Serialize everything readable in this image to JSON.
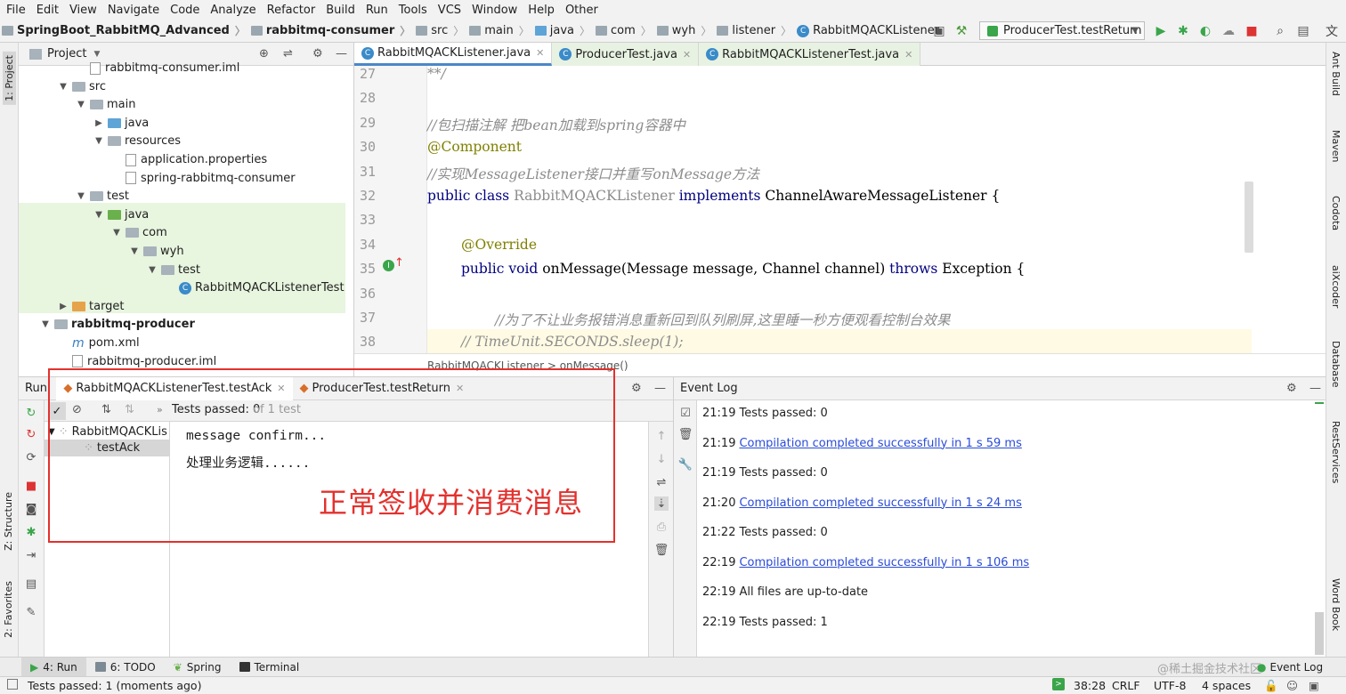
{
  "menu": [
    "File",
    "Edit",
    "View",
    "Navigate",
    "Code",
    "Analyze",
    "Refactor",
    "Build",
    "Run",
    "Tools",
    "VCS",
    "Window",
    "Help",
    "Other"
  ],
  "nav": {
    "crumbs": [
      "SpringBoot_RabbitMQ_Advanced",
      "rabbitmq-consumer",
      "src",
      "main",
      "java",
      "com",
      "wyh",
      "listener",
      "RabbitMQACKListener"
    ],
    "run_config": "ProducerTest.testReturn"
  },
  "left_stripe": {
    "project": "1: Project",
    "structure": "Z: Structure",
    "favorites": "2: Favorites"
  },
  "right_stripe": [
    "Ant Build",
    "Maven",
    "Codota",
    "aiXcoder",
    "Database",
    "RestServices",
    "Word Book"
  ],
  "project": {
    "title": "Project",
    "tree": [
      {
        "label": "rabbitmq-consumer.iml",
        "depth": 3,
        "icon": "file"
      },
      {
        "label": "src",
        "depth": 2,
        "icon": "grey",
        "arrow": "v"
      },
      {
        "label": "main",
        "depth": 3,
        "icon": "grey",
        "arrow": "v"
      },
      {
        "label": "java",
        "depth": 4,
        "icon": "blue",
        "arrow": ">"
      },
      {
        "label": "resources",
        "depth": 4,
        "icon": "grey",
        "arrow": "v"
      },
      {
        "label": "application.properties",
        "depth": 5,
        "icon": "file"
      },
      {
        "label": "spring-rabbitmq-consumer",
        "depth": 5,
        "icon": "file"
      },
      {
        "label": "test",
        "depth": 3,
        "icon": "grey",
        "arrow": "v"
      },
      {
        "label": "java",
        "depth": 4,
        "icon": "green",
        "arrow": "v"
      },
      {
        "label": "com",
        "depth": 5,
        "icon": "grey",
        "arrow": "v"
      },
      {
        "label": "wyh",
        "depth": 6,
        "icon": "grey",
        "arrow": "v"
      },
      {
        "label": "test",
        "depth": 7,
        "icon": "grey",
        "arrow": "v"
      },
      {
        "label": "RabbitMQACKListenerTest",
        "depth": 8,
        "icon": "class"
      },
      {
        "label": "target",
        "depth": 2,
        "icon": "orange",
        "arrow": ">"
      },
      {
        "label": "rabbitmq-producer",
        "depth": 1,
        "icon": "grey",
        "arrow": "v",
        "bold": true
      },
      {
        "label": "pom.xml",
        "depth": 2,
        "icon": "maven"
      },
      {
        "label": "rabbitmq-producer.iml",
        "depth": 2,
        "icon": "file"
      }
    ]
  },
  "editor": {
    "tabs": [
      "RabbitMQACKListener.java",
      "ProducerTest.java",
      "RabbitMQACKListenerTest.java"
    ],
    "lines": [
      {
        "n": "27",
        "text": "**/",
        "kind": "cmt",
        "indent": 0
      },
      {
        "n": "28",
        "text": "",
        "kind": "plain",
        "indent": 0
      },
      {
        "n": "29",
        "text": "//包扫描注解 把bean加载到spring容器中",
        "kind": "cmt",
        "indent": 0
      },
      {
        "n": "30",
        "text": "@Component",
        "kind": "ann",
        "indent": 0
      },
      {
        "n": "31",
        "text": "//实现MessageListener接口并重写onMessage方法",
        "kind": "cmt",
        "indent": 0
      },
      {
        "n": "32",
        "text": "",
        "kind": "classdecl",
        "indent": 0
      },
      {
        "n": "33",
        "text": "",
        "kind": "plain",
        "indent": 0
      },
      {
        "n": "34",
        "text": "@Override",
        "kind": "ann",
        "indent": 1
      },
      {
        "n": "35",
        "text": "",
        "kind": "methoddecl",
        "indent": 1
      },
      {
        "n": "36",
        "text": "",
        "kind": "plain",
        "indent": 0
      },
      {
        "n": "37",
        "text": "//为了不让业务报错消息重新回到队列刷屏,这里睡一秒方便观看控制台效果",
        "kind": "cmt",
        "indent": 2
      },
      {
        "n": "38",
        "text": "// TimeUnit.SECONDS.sleep(1);",
        "kind": "cmt",
        "indent": 1
      }
    ],
    "class_decl": {
      "kw1": "public class ",
      "name": "RabbitMQACKListener ",
      "kw2": "implements ",
      "iface": "ChannelAwareMessageListener {"
    },
    "method_decl": {
      "kw1": "public void ",
      "sig": "onMessage(Message message, Channel channel) ",
      "kw2": "throws ",
      "rest": "Exception {"
    },
    "breadcrumb": "RabbitMQACKListener  >  onMessage()"
  },
  "run": {
    "label": "Run:",
    "tabs": [
      "RabbitMQACKListenerTest.testAck",
      "ProducerTest.testReturn"
    ],
    "status_prefix": "Tests passed: 0",
    "status_suffix": "of 1 test",
    "tree": [
      "RabbitMQACKLis",
      "testAck"
    ],
    "console": [
      "message confirm...",
      "处理业务逻辑......"
    ],
    "annotation": "正常签收并消费消息"
  },
  "event_log": {
    "title": "Event Log",
    "entries": [
      {
        "time": "21:19",
        "text": "Tests passed: 0",
        "link": false
      },
      {
        "time": "21:19",
        "text": "Compilation completed successfully in 1 s 59 ms",
        "link": true
      },
      {
        "time": "21:19",
        "text": "Tests passed: 0",
        "link": false
      },
      {
        "time": "21:20",
        "text": "Compilation completed successfully in 1 s 24 ms",
        "link": true
      },
      {
        "time": "21:22",
        "text": "Tests passed: 0",
        "link": false
      },
      {
        "time": "22:19",
        "text": "Compilation completed successfully in 1 s 106 ms",
        "link": true
      },
      {
        "time": "22:19",
        "text": "All files are up-to-date",
        "link": false
      },
      {
        "time": "22:19",
        "text": "Tests passed: 1",
        "link": false
      }
    ]
  },
  "bottom_tabs": {
    "run": "4: Run",
    "todo": "6: TODO",
    "spring": "Spring",
    "terminal": "Terminal",
    "event_log": "Event Log",
    "watermark": "@稀土掘金技术社区"
  },
  "status": {
    "message": "Tests passed: 1 (moments ago)",
    "position": "38:28",
    "line_sep": "CRLF",
    "encoding": "UTF-8",
    "indent": "4 spaces"
  },
  "colors": {
    "accent": "#4a87c8",
    "annotation_red": "#e3312d",
    "link": "#2a4bd7",
    "test_green_bg": "#e8f5df"
  }
}
